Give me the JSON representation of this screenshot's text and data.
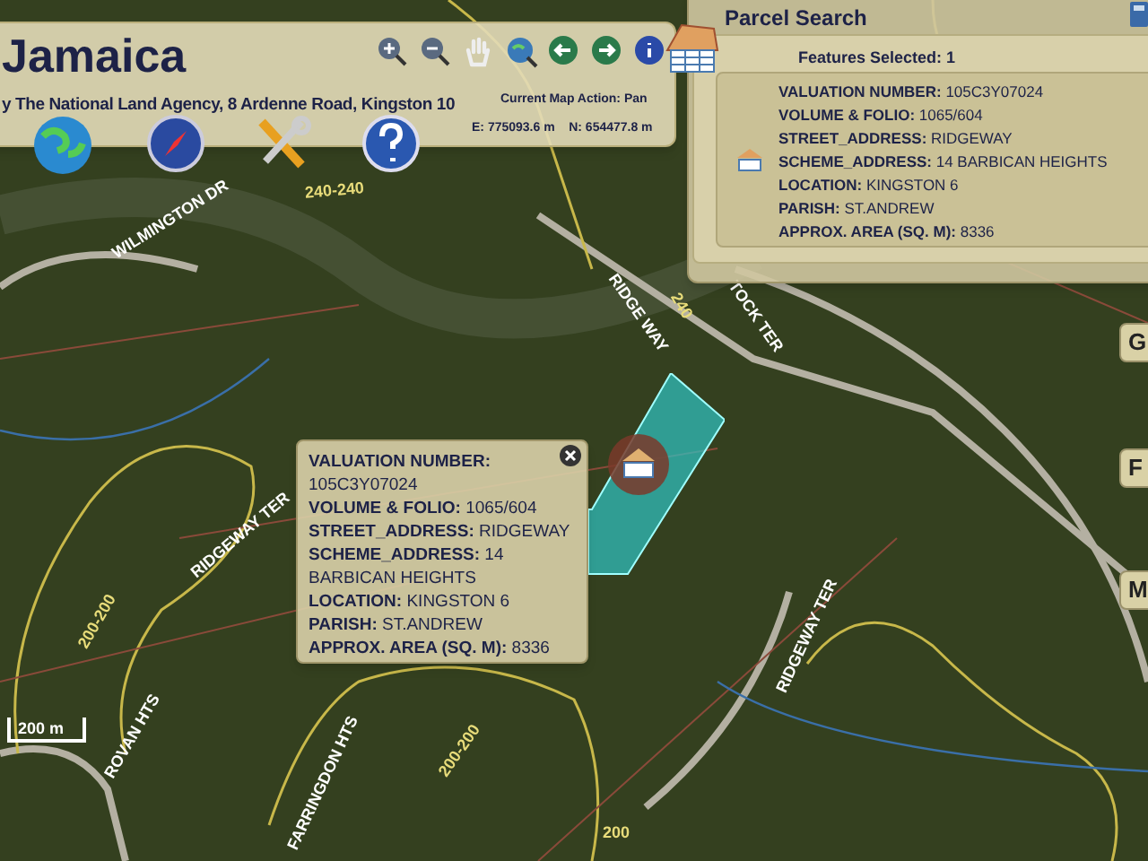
{
  "header": {
    "title": "Jamaica",
    "subtitle": "y The National Land Agency, 8 Ardenne Road, Kingston 10",
    "map_action": "Current Map Action: Pan",
    "coordinates": "E: 775093.6 m    N: 654477.8 m"
  },
  "parcel_search": {
    "title": "Parcel Search",
    "features_selected": "Features Selected: 1",
    "fields": [
      {
        "label": "VALUATION NUMBER:",
        "value": "105C3Y07024"
      },
      {
        "label": "VOLUME & FOLIO:",
        "value": "1065/604"
      },
      {
        "label": "STREET_ADDRESS:",
        "value": "RIDGEWAY"
      },
      {
        "label": "SCHEME_ADDRESS:",
        "value": "14 BARBICAN HEIGHTS"
      },
      {
        "label": "LOCATION:",
        "value": "KINGSTON 6"
      },
      {
        "label": "PARISH:",
        "value": "ST.ANDREW"
      },
      {
        "label": "APPROX. AREA (SQ. M):",
        "value": "8336"
      }
    ]
  },
  "popup": {
    "lines": [
      "**VALUATION NUMBER:**",
      "105C3Y07024",
      "**VOLUME & FOLIO:** 1065/604",
      "**STREET_ADDRESS:** RIDGEWAY",
      "**SCHEME_ADDRESS:** 14",
      "BARBICAN HEIGHTS",
      "**LOCATION:** KINGSTON 6",
      "**PARISH:** ST.ANDREW",
      "**APPROX. AREA (SQ. M):** 8336"
    ]
  },
  "side_tabs": [
    "G",
    "F",
    "M"
  ],
  "map_labels": [
    "WILMINGTON DR",
    "240-240",
    "RIDGE WAY",
    "240",
    "TOCK TER",
    "RIDGEWAY TER",
    "200-200",
    "ROVAN HTS",
    "FARRINGDON HTS",
    "200-200",
    "RIDGEWAY TER",
    "200"
  ],
  "scale": "200 m"
}
